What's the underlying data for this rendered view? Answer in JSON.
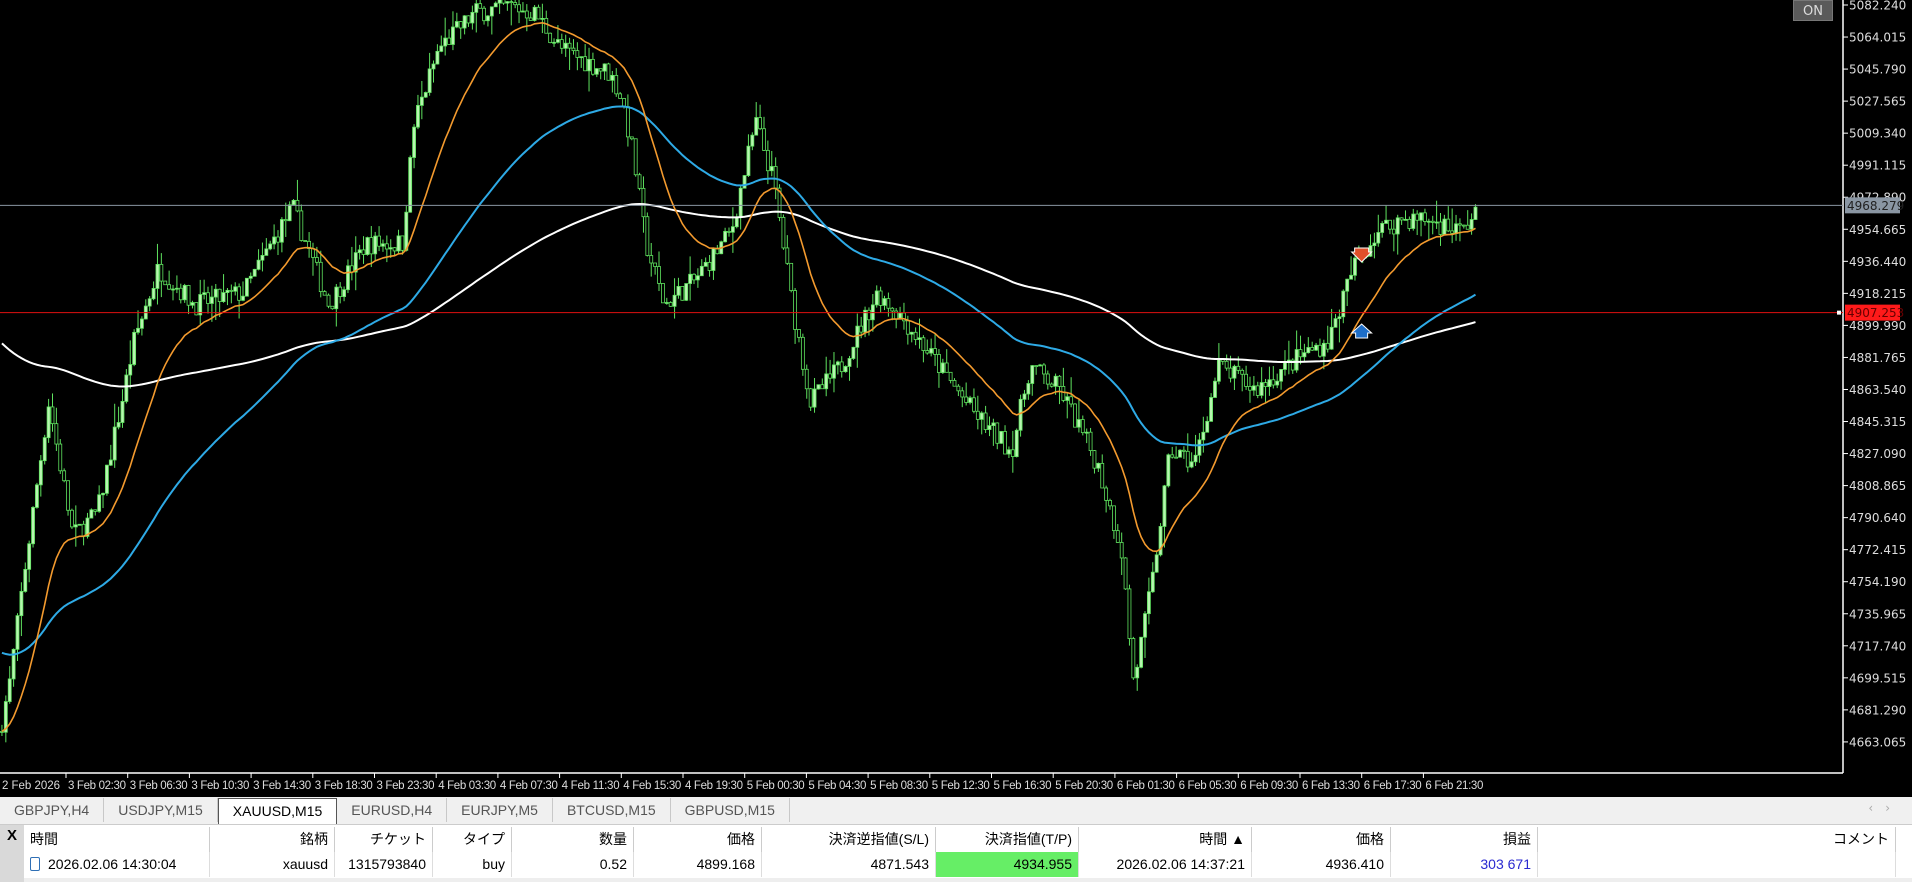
{
  "chart": {
    "symbol_tab_active": "XAUUSD,M15",
    "auto_trading_button": "ON",
    "price_axis": [
      "5082.240",
      "5064.015",
      "5045.790",
      "5027.565",
      "5009.340",
      "4991.115",
      "4972.890",
      "4954.665",
      "4936.440",
      "4918.215",
      "4899.990",
      "4881.765",
      "4863.540",
      "4845.315",
      "4827.090",
      "4808.865",
      "4790.640",
      "4772.415",
      "4754.190",
      "4735.965",
      "4717.740",
      "4699.515",
      "4681.290",
      "4663.065"
    ],
    "bid_price_label": "4968.279",
    "order_price_label": "4907.253",
    "time_axis": [
      "2 Feb 2026",
      "3 Feb 02:30",
      "3 Feb 06:30",
      "3 Feb 10:30",
      "3 Feb 14:30",
      "3 Feb 18:30",
      "3 Feb 23:30",
      "4 Feb 03:30",
      "4 Feb 07:30",
      "4 Feb 11:30",
      "4 Feb 15:30",
      "4 Feb 19:30",
      "5 Feb 00:30",
      "5 Feb 04:30",
      "5 Feb 08:30",
      "5 Feb 12:30",
      "5 Feb 16:30",
      "5 Feb 20:30",
      "6 Feb 01:30",
      "6 Feb 05:30",
      "6 Feb 09:30",
      "6 Feb 13:30",
      "6 Feb 17:30",
      "6 Feb 21:30"
    ],
    "colors": {
      "bull_candle": "#5fe35f",
      "fast_ma": "#f39a2e",
      "mid_ma": "#2eaae6",
      "slow_ma": "#ffffff",
      "order_line": "#e01010",
      "bid_line": "#8a96a3"
    }
  },
  "tabs": [
    "GBPJPY,H4",
    "USDJPY,M15",
    "XAUUSD,M15",
    "EURUSD,H4",
    "EURJPY,M5",
    "BTCUSD,M15",
    "GBPUSD,M15"
  ],
  "trade_table": {
    "close_label": "X",
    "headers": [
      "時間",
      "銘柄",
      "チケット",
      "タイプ",
      "数量",
      "価格",
      "決済逆指値(S/L)",
      "決済指値(T/P)",
      "時間 ▲",
      "価格",
      "損益",
      "コメント"
    ],
    "rows": [
      {
        "open_time": "2026.02.06 14:30:04",
        "symbol": "xauusd",
        "ticket": "1315793840",
        "type": "buy",
        "volume": "0.52",
        "open_price": "4899.168",
        "sl": "4871.543",
        "tp": "4934.955",
        "time": "2026.02.06 14:37:21",
        "price": "4936.410",
        "profit": "303 671",
        "comment": ""
      }
    ]
  }
}
